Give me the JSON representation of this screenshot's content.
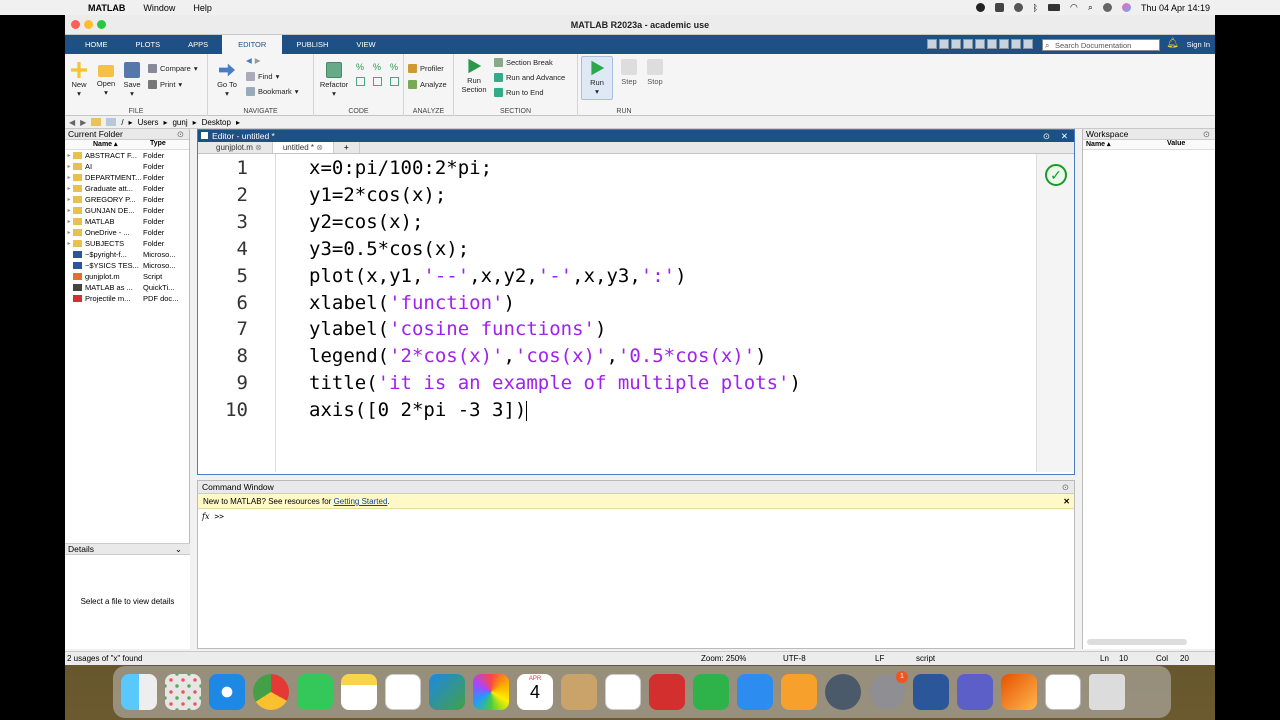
{
  "menubar": {
    "app": "MATLAB",
    "items": [
      "Window",
      "Help"
    ],
    "clock": "Thu 04 Apr  14:19"
  },
  "window": {
    "title": "MATLAB R2023a - academic use"
  },
  "ribbon_tabs": [
    "HOME",
    "PLOTS",
    "APPS",
    "EDITOR",
    "PUBLISH",
    "VIEW"
  ],
  "active_tab": "EDITOR",
  "search_doc": {
    "placeholder": "Search Documentation"
  },
  "signin": "Sign In",
  "ribbon": {
    "file": {
      "label": "FILE",
      "new": "New",
      "open": "Open",
      "save": "Save",
      "compare": "Compare",
      "print": "Print"
    },
    "navigate": {
      "label": "NAVIGATE",
      "goto": "Go To",
      "find": "Find",
      "bookmark": "Bookmark"
    },
    "code": {
      "label": "CODE",
      "refactor": "Refactor"
    },
    "analyze": {
      "label": "ANALYZE",
      "profiler": "Profiler",
      "analyze": "Analyze"
    },
    "section": {
      "label": "SECTION",
      "run_section": "Run Section",
      "section_break": "Section Break",
      "run_advance": "Run and Advance",
      "run_to_end": "Run to End"
    },
    "run": {
      "label": "RUN",
      "run": "Run",
      "step": "Step",
      "stop": "Stop"
    }
  },
  "address": [
    "/",
    "Users",
    "gunj",
    "Desktop"
  ],
  "current_folder": {
    "title": "Current Folder",
    "col_name": "Name ▴",
    "col_type": "Type",
    "rows": [
      {
        "name": "ABSTRACT F...",
        "type": "Folder",
        "icon": "folder"
      },
      {
        "name": "AI",
        "type": "Folder",
        "icon": "folder"
      },
      {
        "name": "DEPARTMENT...",
        "type": "Folder",
        "icon": "folder"
      },
      {
        "name": "Graduate att...",
        "type": "Folder",
        "icon": "folder"
      },
      {
        "name": "GREGORY P...",
        "type": "Folder",
        "icon": "folder"
      },
      {
        "name": "GUNJAN DE...",
        "type": "Folder",
        "icon": "folder"
      },
      {
        "name": "MATLAB",
        "type": "Folder",
        "icon": "folder"
      },
      {
        "name": "OneDrive - ...",
        "type": "Folder",
        "icon": "folder"
      },
      {
        "name": "SUBJECTS",
        "type": "Folder",
        "icon": "folder"
      },
      {
        "name": "~$pyright-f...",
        "type": "Microso...",
        "icon": "doc"
      },
      {
        "name": "~$YSICS TES...",
        "type": "Microso...",
        "icon": "doc"
      },
      {
        "name": "gunjplot.m",
        "type": "Script",
        "icon": "script"
      },
      {
        "name": "MATLAB as ...",
        "type": "QuickTi...",
        "icon": "video"
      },
      {
        "name": "Projectile m...",
        "type": "PDF doc...",
        "icon": "pdf"
      }
    ]
  },
  "details": {
    "title": "Details",
    "empty": "Select a file to view details"
  },
  "editor": {
    "title": "Editor - untitled *",
    "tabs": [
      "gunjplot.m",
      "untitled *"
    ],
    "lines": [
      {
        "n": "1",
        "parts": [
          [
            "x=0:pi/100:2*pi;",
            ""
          ]
        ]
      },
      {
        "n": "2",
        "parts": [
          [
            "y1=2*cos(x);",
            ""
          ]
        ]
      },
      {
        "n": "3",
        "parts": [
          [
            "y2=cos(x);",
            ""
          ]
        ]
      },
      {
        "n": "4",
        "parts": [
          [
            "y3=0.5*cos(x);",
            ""
          ]
        ]
      },
      {
        "n": "5",
        "parts": [
          [
            "plot(x,y1,",
            ""
          ],
          [
            "'--'",
            "str"
          ],
          [
            ",x,y2,",
            ""
          ],
          [
            "'-'",
            "str"
          ],
          [
            ",x,y3,",
            ""
          ],
          [
            "':'",
            "str"
          ],
          [
            ")",
            ""
          ]
        ]
      },
      {
        "n": "6",
        "parts": [
          [
            "xlabel(",
            ""
          ],
          [
            "'function'",
            "str"
          ],
          [
            ")",
            ""
          ]
        ]
      },
      {
        "n": "7",
        "parts": [
          [
            "ylabel(",
            ""
          ],
          [
            "'cosine functions'",
            "str"
          ],
          [
            ")",
            ""
          ]
        ]
      },
      {
        "n": "8",
        "parts": [
          [
            "legend(",
            ""
          ],
          [
            "'2*cos(x)'",
            "str"
          ],
          [
            ",",
            ""
          ],
          [
            "'cos(x)'",
            "str"
          ],
          [
            ",",
            ""
          ],
          [
            "'0.5*cos(x)'",
            "str"
          ],
          [
            ")",
            ""
          ]
        ]
      },
      {
        "n": "9",
        "parts": [
          [
            "title(",
            ""
          ],
          [
            "'it is an example of multiple plots'",
            "str"
          ],
          [
            ")",
            ""
          ]
        ]
      },
      {
        "n": "10",
        "parts": [
          [
            "axis([0 2*pi -3 3])",
            ""
          ]
        ]
      }
    ]
  },
  "command_window": {
    "title": "Command Window",
    "note": "New to MATLAB? See resources for ",
    "note_link": "Getting Started",
    "note_end": ".",
    "fx": "fx",
    "prompt": ">>"
  },
  "workspace": {
    "title": "Workspace",
    "col_name": "Name ▴",
    "col_value": "Value"
  },
  "status": {
    "left": "2 usages of \"x\" found",
    "zoom": "Zoom: 250%",
    "encoding": "UTF-8",
    "eol": "LF",
    "type": "script",
    "ln_label": "Ln",
    "ln": "10",
    "col_label": "Col",
    "col": "20"
  },
  "dock": {
    "calendar_month": "APR",
    "calendar_day": "4",
    "notification_badge": "1"
  },
  "colors": {
    "ribbon_blue": "#1e4f85",
    "string_purple": "#a020f0",
    "ok_green": "#1a9a2a"
  }
}
